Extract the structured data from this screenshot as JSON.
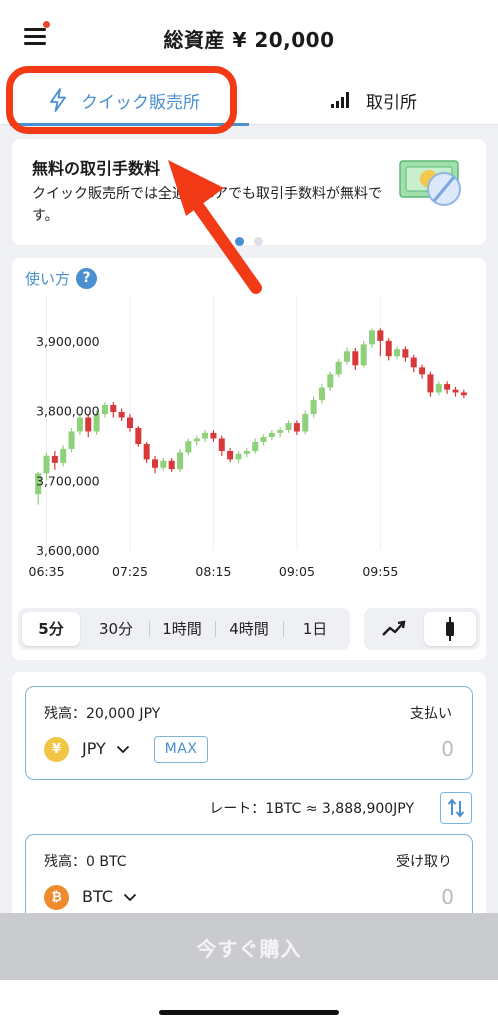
{
  "header": {
    "title": "総資産 ¥ 20,000"
  },
  "tabs": [
    {
      "label": "クイック販売所",
      "icon": "lightning-icon",
      "active": true
    },
    {
      "label": "取引所",
      "icon": "signal-bars-icon",
      "active": false
    }
  ],
  "promo": {
    "title": "無料の取引手数料",
    "text": "クイック販売所では全通貨ペアでも取引手数料が無料です。",
    "page_count": 2,
    "active_page": 1
  },
  "chart": {
    "howto_label": "使い方",
    "help_symbol": "?",
    "timeframes": [
      "5分",
      "30分",
      "1時間",
      "4時間",
      "1日"
    ],
    "active_timeframe": "5分",
    "chart_types": [
      "line-chart-icon",
      "candlestick-icon"
    ],
    "active_chart_type": "candlestick-icon"
  },
  "chart_data": {
    "type": "candlestick",
    "xlabels": [
      "06:35",
      "07:25",
      "08:15",
      "09:05",
      "09:55"
    ],
    "ylabels": [
      "3,900,000",
      "3,800,000",
      "3,700,000",
      "3,600,000"
    ],
    "yticks": [
      3900000,
      3800000,
      3700000,
      3600000
    ],
    "ylim": [
      3600000,
      3950000
    ],
    "colors": {
      "up": "#8fd07a",
      "down": "#d9383a"
    },
    "grid": "vertical",
    "candles": [
      [
        3680000,
        3710000,
        3665000,
        3712000
      ],
      [
        3710000,
        3735000,
        3700000,
        3740000
      ],
      [
        3735000,
        3725000,
        3715000,
        3742000
      ],
      [
        3725000,
        3745000,
        3720000,
        3750000
      ],
      [
        3745000,
        3770000,
        3740000,
        3775000
      ],
      [
        3770000,
        3790000,
        3765000,
        3795000
      ],
      [
        3790000,
        3770000,
        3762000,
        3795000
      ],
      [
        3770000,
        3795000,
        3765000,
        3800000
      ],
      [
        3795000,
        3808000,
        3790000,
        3812000
      ],
      [
        3808000,
        3798000,
        3790000,
        3812000
      ],
      [
        3798000,
        3790000,
        3785000,
        3803000
      ],
      [
        3790000,
        3775000,
        3770000,
        3795000
      ],
      [
        3775000,
        3752000,
        3748000,
        3778000
      ],
      [
        3752000,
        3730000,
        3725000,
        3755000
      ],
      [
        3730000,
        3718000,
        3710000,
        3735000
      ],
      [
        3718000,
        3728000,
        3714000,
        3732000
      ],
      [
        3728000,
        3716000,
        3712000,
        3732000
      ],
      [
        3716000,
        3740000,
        3712000,
        3745000
      ],
      [
        3740000,
        3756000,
        3736000,
        3760000
      ],
      [
        3756000,
        3760000,
        3750000,
        3764000
      ],
      [
        3760000,
        3768000,
        3755000,
        3772000
      ],
      [
        3768000,
        3760000,
        3755000,
        3772000
      ],
      [
        3760000,
        3742000,
        3735000,
        3764000
      ],
      [
        3742000,
        3730000,
        3726000,
        3746000
      ],
      [
        3730000,
        3738000,
        3725000,
        3742000
      ],
      [
        3738000,
        3742000,
        3733000,
        3746000
      ],
      [
        3742000,
        3755000,
        3738000,
        3760000
      ],
      [
        3755000,
        3762000,
        3750000,
        3766000
      ],
      [
        3762000,
        3768000,
        3758000,
        3772000
      ],
      [
        3768000,
        3772000,
        3762000,
        3776000
      ],
      [
        3772000,
        3782000,
        3768000,
        3786000
      ],
      [
        3782000,
        3770000,
        3765000,
        3786000
      ],
      [
        3770000,
        3795000,
        3766000,
        3800000
      ],
      [
        3795000,
        3815000,
        3790000,
        3820000
      ],
      [
        3815000,
        3833000,
        3810000,
        3838000
      ],
      [
        3833000,
        3852000,
        3828000,
        3856000
      ],
      [
        3852000,
        3870000,
        3848000,
        3874000
      ],
      [
        3870000,
        3885000,
        3866000,
        3890000
      ],
      [
        3885000,
        3865000,
        3858000,
        3890000
      ],
      [
        3865000,
        3895000,
        3862000,
        3900000
      ],
      [
        3895000,
        3915000,
        3890000,
        3918000
      ],
      [
        3915000,
        3900000,
        3878000,
        3918000
      ],
      [
        3900000,
        3878000,
        3872000,
        3904000
      ],
      [
        3878000,
        3888000,
        3874000,
        3892000
      ],
      [
        3888000,
        3876000,
        3870000,
        3892000
      ],
      [
        3876000,
        3862000,
        3855000,
        3880000
      ],
      [
        3862000,
        3852000,
        3846000,
        3866000
      ],
      [
        3852000,
        3826000,
        3820000,
        3856000
      ],
      [
        3826000,
        3838000,
        3822000,
        3842000
      ],
      [
        3838000,
        3830000,
        3824000,
        3842000
      ],
      [
        3830000,
        3826000,
        3820000,
        3834000
      ],
      [
        3826000,
        3822000,
        3818000,
        3830000
      ]
    ]
  },
  "trade": {
    "pay": {
      "balance": "残高：20,000 JPY",
      "role": "支払い",
      "coin_symbol": "¥",
      "currency": "JPY",
      "max_label": "MAX",
      "placeholder": "0"
    },
    "rate": "レート：1BTC ≈ 3,888,900JPY",
    "receive": {
      "balance": "残高：0 BTC",
      "role": "受け取り",
      "coin_symbol": "₿",
      "currency": "BTC",
      "placeholder": "0"
    }
  },
  "buy_button": {
    "label": "今すぐ購入"
  },
  "accent_colors": {
    "primary": "#4a8fd0",
    "annotation": "#f23a16",
    "button_disabled": "#c9cbcf"
  }
}
